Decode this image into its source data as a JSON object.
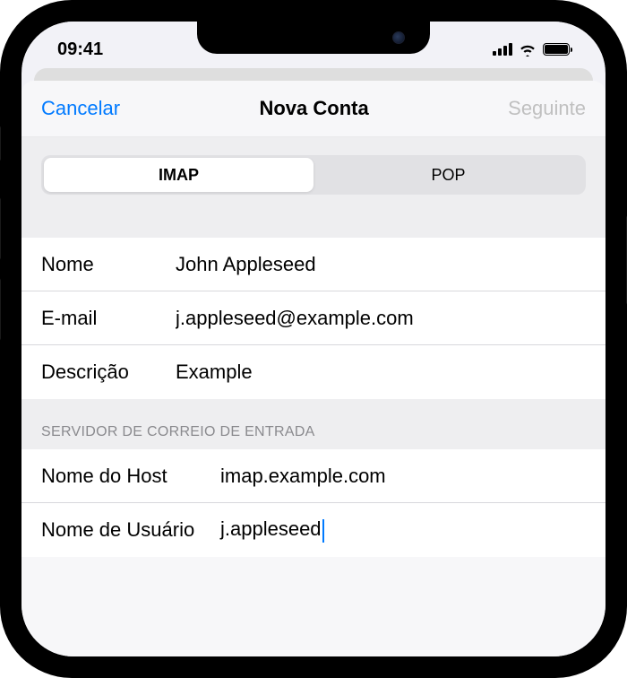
{
  "statusBar": {
    "time": "09:41"
  },
  "nav": {
    "cancel": "Cancelar",
    "title": "Nova Conta",
    "next": "Seguinte"
  },
  "protocol": {
    "options": [
      "IMAP",
      "POP"
    ],
    "selected": "IMAP"
  },
  "account": {
    "nameLabel": "Nome",
    "nameValue": "John Appleseed",
    "emailLabel": "E-mail",
    "emailValue": "j.appleseed@example.com",
    "descriptionLabel": "Descrição",
    "descriptionValue": "Example"
  },
  "incomingServer": {
    "header": "SERVIDOR DE CORREIO DE ENTRADA",
    "hostLabel": "Nome do Host",
    "hostValue": "imap.example.com",
    "userLabel": "Nome de Usuário",
    "userValue": "j.appleseed"
  }
}
